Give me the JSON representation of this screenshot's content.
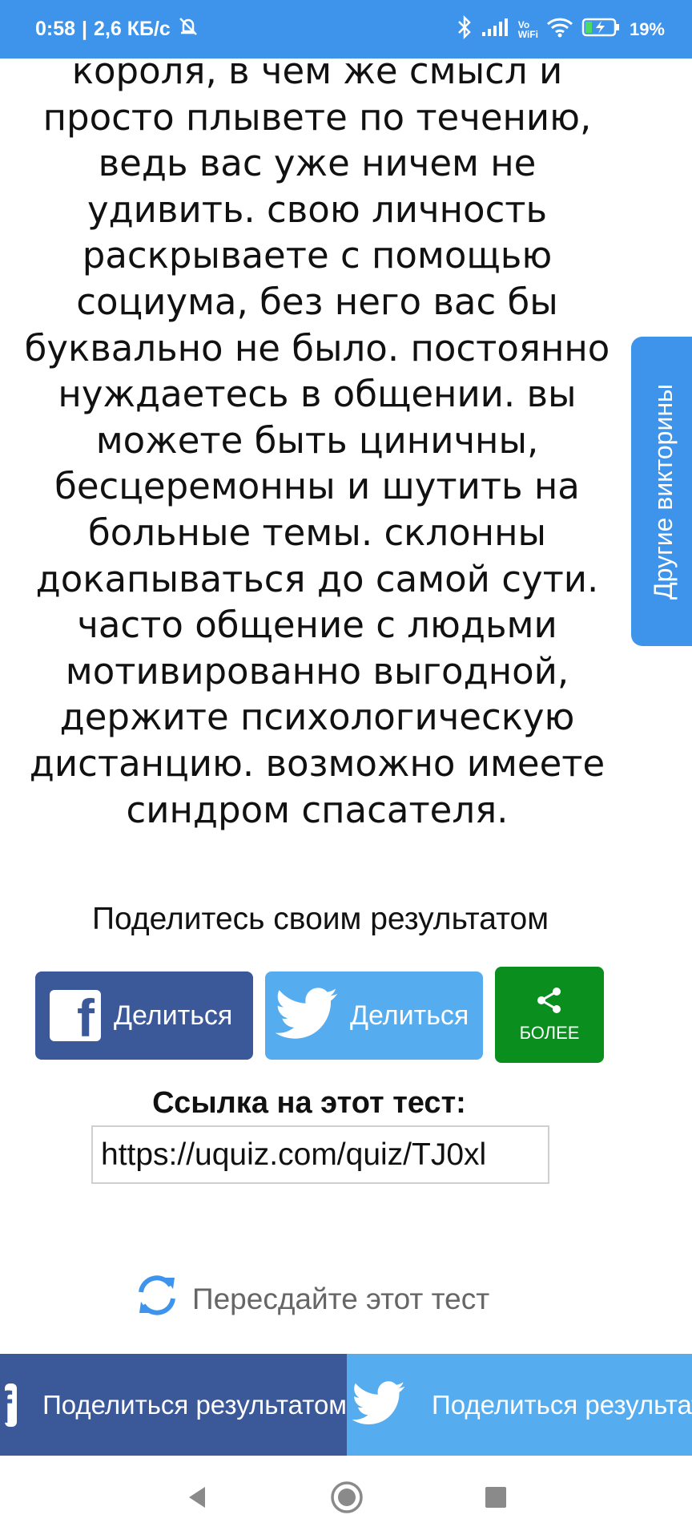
{
  "status": {
    "time": "0:58",
    "speed": "2,6 КБ/с",
    "vowifi_top": "Vo",
    "vowifi_bottom": "WiFi",
    "battery": "19%"
  },
  "result": {
    "text": "короля, в чем же смысл и просто плывете по течению, ведь вас уже ничем не удивить. свою личность раскрываете с помощью социума, без него вас бы буквально не было. постоянно нуждаетесь в общении. вы можете быть циничны, бесцеремонны и шутить на больные темы. склонны докапываться до самой сути. часто общение с людьми мотивированно выгодной, держите психологическую дистанцию. возможно имеете синдром спасателя."
  },
  "side_tab": {
    "label": "Другие викторины"
  },
  "share": {
    "heading": "Поделитесь своим результатом",
    "facebook_label": "Делиться",
    "twitter_label": "Делиться",
    "more_label": "БОЛЕЕ"
  },
  "link": {
    "label": "Ссылка на этот тест:",
    "url": "https://uquiz.com/quiz/TJ0xl"
  },
  "retake": {
    "label": "Пересдайте этот тест"
  },
  "bottom_bar": {
    "facebook_label": "Поделиться результатом",
    "twitter_label": "Поделиться результатом"
  },
  "colors": {
    "accent": "#3e93ea",
    "facebook": "#3b5998",
    "twitter": "#55acee",
    "more": "#0a8f1e"
  }
}
